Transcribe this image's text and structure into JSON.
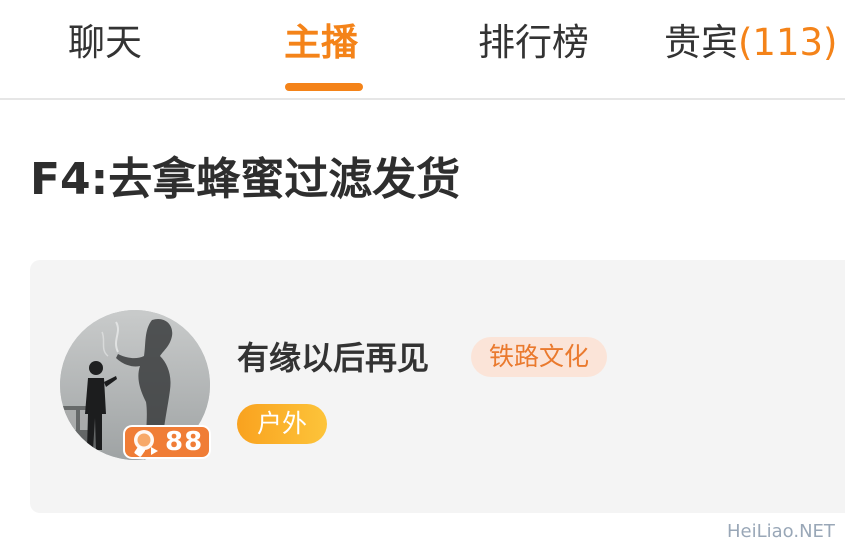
{
  "tabs": {
    "chat": "聊天",
    "host": "主播",
    "rank": "排行榜",
    "vip_label": "贵宾",
    "vip_count": "(113)"
  },
  "active_tab": "host",
  "section": {
    "title": "F4:去拿蜂蜜过滤发货"
  },
  "card": {
    "host_name": "有缘以后再见",
    "category_tag": "铁路文化",
    "type_tag": "户外",
    "live_count": "88"
  },
  "watermark": "HeiLiao.NET",
  "colors": {
    "accent": "#f48319",
    "tag_bg": "#fbe4d8",
    "card_bg": "#f4f4f4"
  }
}
